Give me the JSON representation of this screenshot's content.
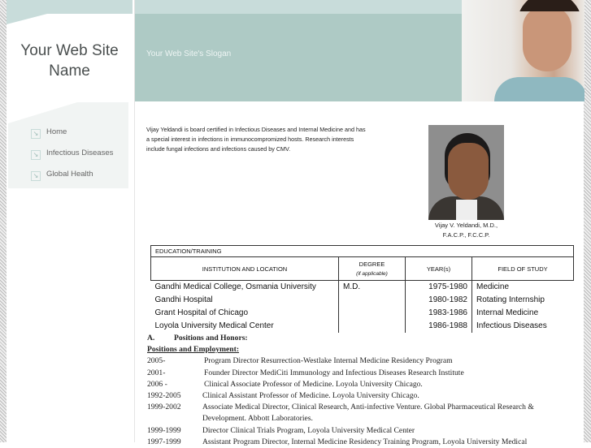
{
  "site": {
    "name": "Your Web Site Name",
    "slogan": "Your Web Site's Slogan"
  },
  "nav": [
    {
      "label": "Home"
    },
    {
      "label": "Infectious Diseases"
    },
    {
      "label": "Global Health"
    }
  ],
  "bio": "Vijay Yeldandi is board certified in Infectious Diseases and Internal Medicine and has a special interest in infections in immunocompromized hosts. Research interests include fungal infections and infections caused by CMV.",
  "portrait": {
    "caption_line1": "Vijay V. Yeldandi, M.D.,",
    "caption_line2": "F.A.C.P., F.C.C.P."
  },
  "education": {
    "title": "EDUCATION/TRAINING",
    "headers": {
      "institution": "INSTITUTION AND LOCATION",
      "degree": "DEGREE",
      "degree_note": "(if applicable)",
      "years": "YEAR(s)",
      "field": "FIELD OF STUDY"
    },
    "rows": [
      {
        "institution": "Gandhi Medical College, Osmania University",
        "degree": "M.D.",
        "years": "1975-1980",
        "field": "Medicine"
      },
      {
        "institution": "Gandhi Hospital",
        "degree": "",
        "years": "1980-1982",
        "field": "Rotating Internship"
      },
      {
        "institution": "Grant Hospital of Chicago",
        "degree": "",
        "years": "1983-1986",
        "field": "Internal Medicine"
      },
      {
        "institution": "Loyola University Medical Center",
        "degree": "",
        "years": "1986-1988",
        "field": "Infectious Diseases"
      }
    ]
  },
  "cv": {
    "section_letter": "A.",
    "section_title": "Positions and Honors:",
    "subsection": "Positions and Employment:",
    "positions": [
      {
        "years": "2005-",
        "text": "Program Director Resurrection-Westlake Internal Medicine Residency Program"
      },
      {
        "years": "2001-",
        "text": "Founder Director MediCiti Immunology and Infectious Diseases Research Institute"
      },
      {
        "years": "2006 -",
        "text": "Clinical Associate Professor of Medicine. Loyola University Chicago."
      },
      {
        "years": "1992-2005",
        "text": "Clinical Assistant Professor of Medicine. Loyola University Chicago."
      },
      {
        "years": "1999-2002",
        "text": "Associate Medical Director, Clinical Research, Anti-infective Venture. Global Pharmaceutical  Research & Development. Abbott Laboratories."
      },
      {
        "years": "1999-1999",
        "text": "Director Clinical Trials Program, Loyola University Medical Center"
      },
      {
        "years": "1997-1999",
        "text": "Assistant Program Director, Internal Medicine Residency Training Program, Loyola University Medical"
      }
    ]
  }
}
